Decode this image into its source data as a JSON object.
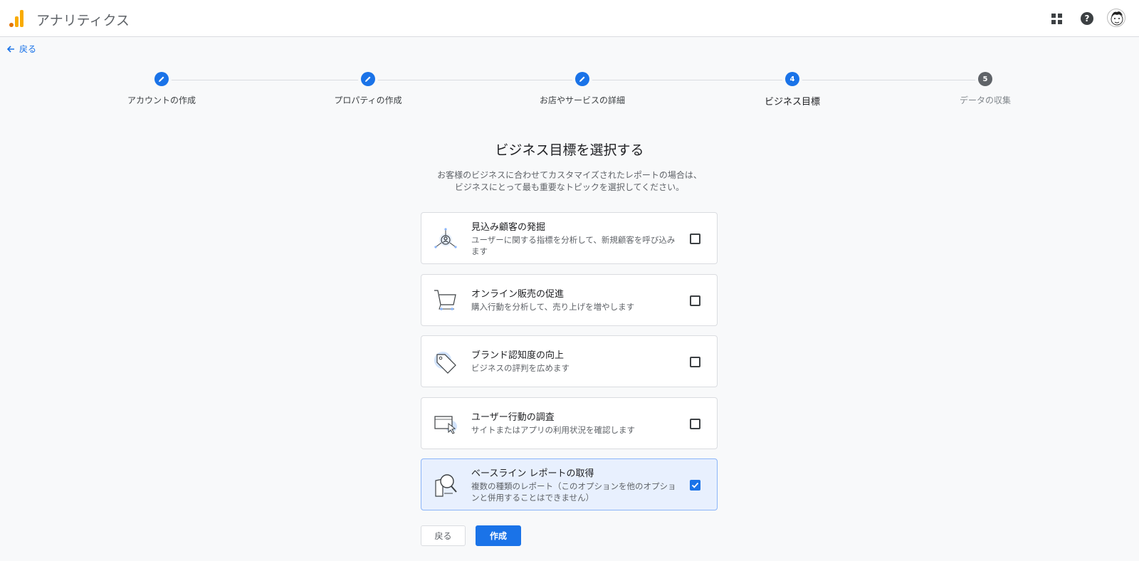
{
  "app": {
    "title": "アナリティクス"
  },
  "nav": {
    "back_label": "戻る"
  },
  "colors": {
    "accent": "#1a73e8",
    "brand_orange": "#f9ab00",
    "brand_dark_orange": "#e37400"
  },
  "stepper": {
    "steps": [
      {
        "label": "アカウントの作成",
        "state": "done",
        "icon": "edit-icon"
      },
      {
        "label": "プロパティの作成",
        "state": "done",
        "icon": "edit-icon"
      },
      {
        "label": "お店やサービスの詳細",
        "state": "done",
        "icon": "edit-icon"
      },
      {
        "label": "ビジネス目標",
        "state": "active",
        "number": "4"
      },
      {
        "label": "データの収集",
        "state": "todo",
        "number": "5"
      }
    ]
  },
  "main": {
    "heading": "ビジネス目標を選択する",
    "description_line1": "お客様のビジネスに合わせてカスタマイズされたレポートの場合は、",
    "description_line2": "ビジネスにとって最も重要なトピックを選択してください。",
    "objectives": [
      {
        "title": "見込み顧客の発掘",
        "desc_line1": "ユーザーに関する指標を分析して、新規顧客を呼び込み",
        "desc_line2": "ます",
        "icon": "lead-generation-icon",
        "checked": false
      },
      {
        "title": "オンライン販売の促進",
        "desc_line1": "購入行動を分析して、売り上げを増やします",
        "desc_line2": "",
        "icon": "shopping-cart-icon",
        "checked": false
      },
      {
        "title": "ブランド認知度の向上",
        "desc_line1": "ビジネスの評判を広めます",
        "desc_line2": "",
        "icon": "price-tag-icon",
        "checked": false
      },
      {
        "title": "ユーザー行動の調査",
        "desc_line1": "サイトまたはアプリの利用状況を確認します",
        "desc_line2": "",
        "icon": "browser-cursor-icon",
        "checked": false
      },
      {
        "title": "ベースライン レポートの取得",
        "desc_line1": "複数の種類のレポート（このオプションを他のオプショ",
        "desc_line2": "ンと併用することはできません）",
        "icon": "magnifier-report-icon",
        "checked": true
      }
    ]
  },
  "buttons": {
    "back_label": "戻る",
    "create_label": "作成"
  }
}
